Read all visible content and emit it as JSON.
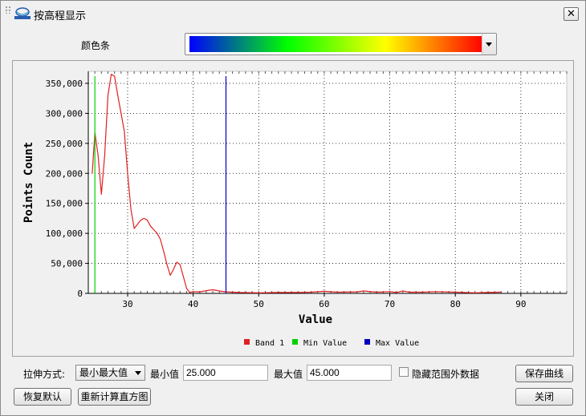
{
  "window": {
    "title": "按高程显示",
    "close_glyph": "✕"
  },
  "colorbar": {
    "label": "颜色条",
    "stops": [
      "#0000ff",
      "#00ff00",
      "#ffff00",
      "#ff0000"
    ]
  },
  "chart_data": {
    "type": "line",
    "xlabel": "Value",
    "ylabel": "Points Count",
    "xlim": [
      24,
      97
    ],
    "ylim": [
      0,
      370000
    ],
    "xticks": [
      30,
      40,
      50,
      60,
      70,
      80,
      90
    ],
    "yticks": [
      0,
      50000,
      100000,
      150000,
      200000,
      250000,
      300000,
      350000
    ],
    "ytick_labels": [
      "0",
      "50,000",
      "100,000",
      "150,000",
      "200,000",
      "250,000",
      "300,000",
      "350,000"
    ],
    "grid": true,
    "legend_position": "bottom",
    "series": [
      {
        "name": "Band 1",
        "color": "#e02020",
        "x": [
          24.6,
          25.0,
          25.5,
          26.0,
          26.5,
          27.0,
          27.5,
          28.0,
          28.5,
          29.0,
          29.5,
          30.0,
          30.5,
          31.0,
          31.5,
          32.0,
          32.5,
          33.0,
          33.5,
          34.0,
          34.5,
          35.0,
          35.5,
          36.0,
          36.5,
          37.0,
          37.5,
          38.0,
          38.5,
          39.0,
          39.5,
          40.0,
          41.0,
          42.0,
          43.0,
          44.0,
          45.0,
          47.0,
          50.0,
          53.0,
          56.0,
          58.0,
          60.0,
          62.0,
          65.0,
          66.0,
          68.0,
          70.0,
          71.0,
          72.0,
          73.0,
          75.0,
          77.0,
          80.0,
          83.0,
          85.0,
          87.0
        ],
        "y": [
          200000,
          268000,
          230000,
          165000,
          230000,
          330000,
          365000,
          362000,
          330000,
          300000,
          270000,
          200000,
          140000,
          108000,
          115000,
          122000,
          125000,
          122000,
          112000,
          106000,
          100000,
          90000,
          70000,
          48000,
          30000,
          40000,
          52000,
          48000,
          28000,
          8000,
          1500,
          3000,
          2500,
          4500,
          6000,
          4000,
          2500,
          1500,
          1000,
          1500,
          1500,
          2000,
          3500,
          2000,
          2500,
          4000,
          2000,
          3000,
          1500,
          4000,
          2000,
          2000,
          3000,
          2000,
          1000,
          1500,
          2000
        ]
      },
      {
        "name": "Min Value",
        "color": "#00d000",
        "x": [
          25.0,
          25.0
        ],
        "y": [
          0,
          362000
        ]
      },
      {
        "name": "Max Value",
        "color": "#0000c0",
        "x": [
          45.0,
          45.0
        ],
        "y": [
          0,
          362000
        ]
      }
    ]
  },
  "controls": {
    "stretch_label": "拉伸方式:",
    "stretch_value": "最小最大值",
    "min_label": "最小值",
    "min_value": "25.000",
    "max_label": "最大值",
    "max_value": "45.000",
    "hide_label": "隐藏范围外数据",
    "save_curve": "保存曲线",
    "restore_default": "恢复默认",
    "recompute": "重新计算直方图",
    "close": "关闭"
  }
}
